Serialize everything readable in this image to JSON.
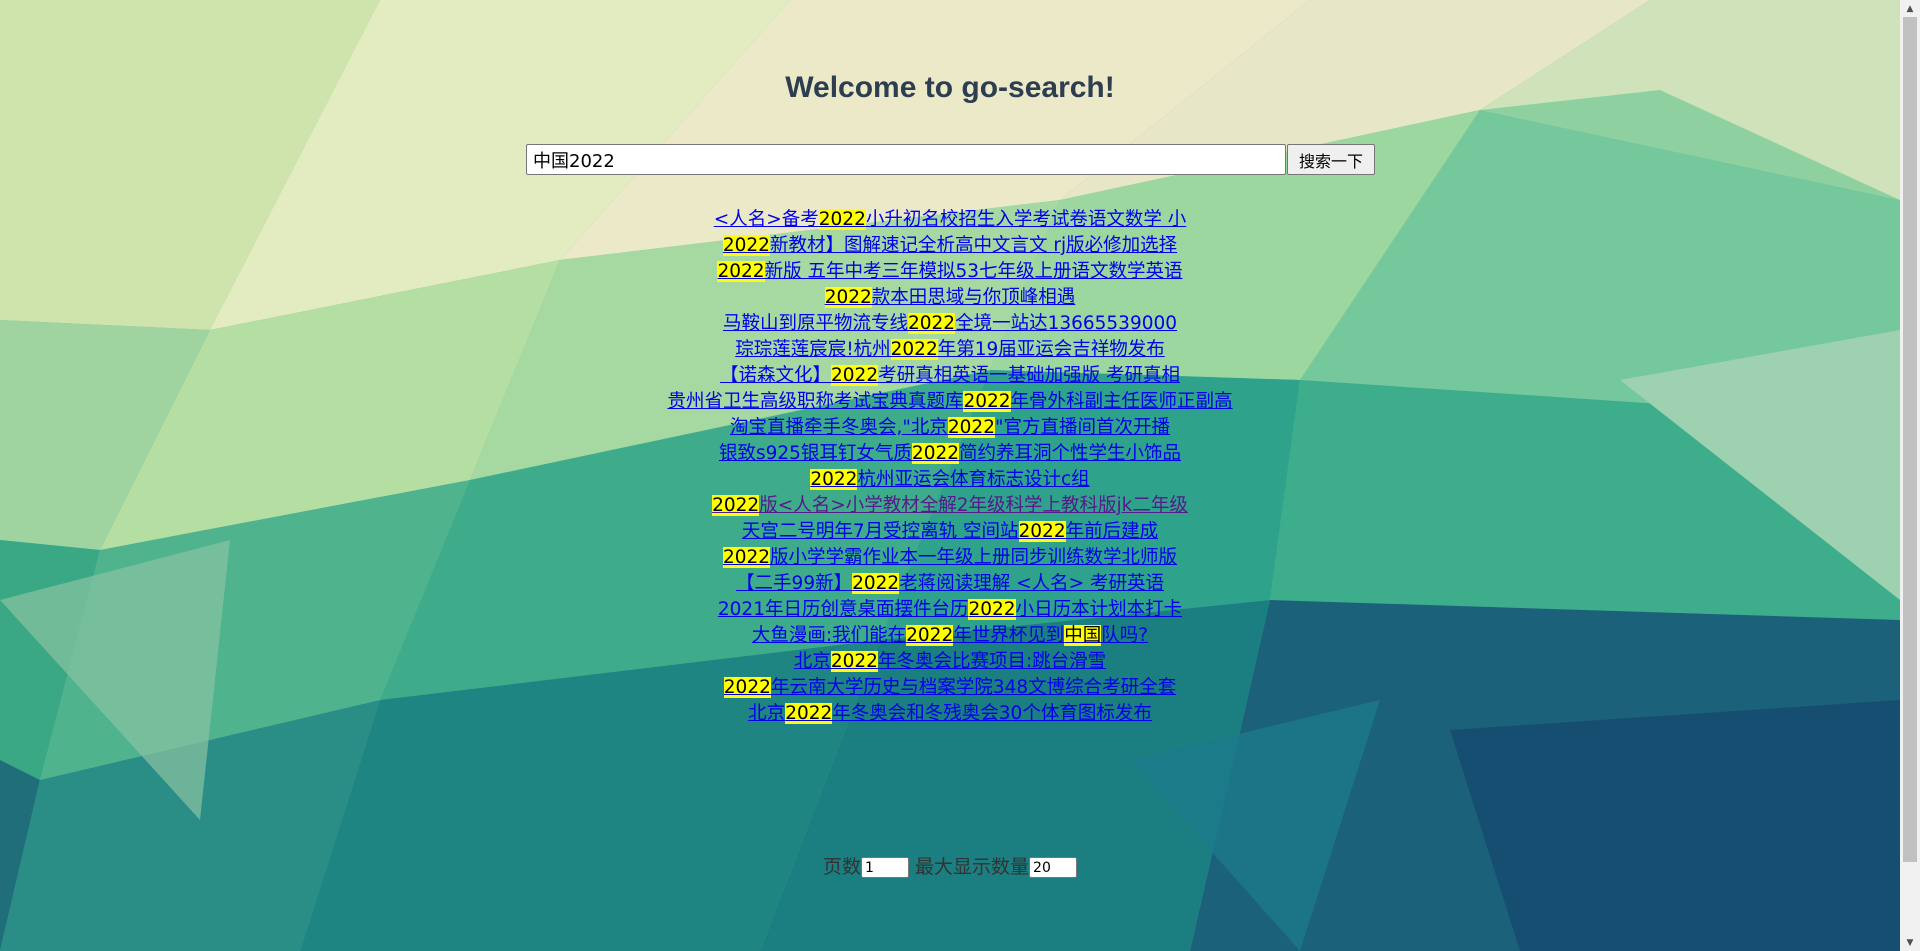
{
  "page": {
    "title": "Welcome to go-search!"
  },
  "search": {
    "value": "中国2022",
    "button_label": "搜索一下"
  },
  "results": [
    {
      "visited": false,
      "parts": [
        {
          "t": "<人名>备考"
        },
        {
          "t": "2022",
          "h": true
        },
        {
          "t": "小升初名校招生入学考试卷语文数学 小"
        }
      ]
    },
    {
      "visited": false,
      "parts": [
        {
          "t": "2022",
          "h": true
        },
        {
          "t": "新教材】图解速记全析高中文言文 rj版必修加选择"
        }
      ]
    },
    {
      "visited": false,
      "parts": [
        {
          "t": "2022",
          "h": true
        },
        {
          "t": "新版 五年中考三年模拟53七年级上册语文数学英语"
        }
      ]
    },
    {
      "visited": false,
      "parts": [
        {
          "t": "2022",
          "h": true
        },
        {
          "t": "款本田思域与你顶峰相遇"
        }
      ]
    },
    {
      "visited": false,
      "parts": [
        {
          "t": "马鞍山到原平物流专线"
        },
        {
          "t": "2022",
          "h": true
        },
        {
          "t": "全境一站达13665539000"
        }
      ]
    },
    {
      "visited": false,
      "parts": [
        {
          "t": "琮琮莲莲宸宸!杭州"
        },
        {
          "t": "2022",
          "h": true
        },
        {
          "t": "年第19届亚运会吉祥物发布"
        }
      ]
    },
    {
      "visited": false,
      "parts": [
        {
          "t": "【诺森文化】"
        },
        {
          "t": "2022",
          "h": true
        },
        {
          "t": "考研真相英语一基础加强版 考研真相"
        }
      ]
    },
    {
      "visited": false,
      "parts": [
        {
          "t": "贵州省卫生高级职称考试宝典真题库"
        },
        {
          "t": "2022",
          "h": true
        },
        {
          "t": "年骨外科副主任医师正副高"
        }
      ]
    },
    {
      "visited": false,
      "parts": [
        {
          "t": "淘宝直播牵手冬奥会,\"北京"
        },
        {
          "t": "2022",
          "h": true
        },
        {
          "t": "\"官方直播间首次开播"
        }
      ]
    },
    {
      "visited": false,
      "parts": [
        {
          "t": "银致s925银耳钉女气质"
        },
        {
          "t": "2022",
          "h": true
        },
        {
          "t": "简约养耳洞个性学生小饰品"
        }
      ]
    },
    {
      "visited": false,
      "parts": [
        {
          "t": "2022",
          "h": true
        },
        {
          "t": "杭州亚运会体育标志设计c组"
        }
      ]
    },
    {
      "visited": true,
      "parts": [
        {
          "t": "2022",
          "h": true
        },
        {
          "t": "版<人名>小学教材全解2年级科学上教科版jk二年级"
        }
      ]
    },
    {
      "visited": false,
      "parts": [
        {
          "t": "天宫二号明年7月受控离轨 空间站"
        },
        {
          "t": "2022",
          "h": true
        },
        {
          "t": "年前后建成"
        }
      ]
    },
    {
      "visited": false,
      "parts": [
        {
          "t": "2022",
          "h": true
        },
        {
          "t": "版小学学霸作业本一年级上册同步训练数学北师版"
        }
      ]
    },
    {
      "visited": false,
      "parts": [
        {
          "t": "【二手99新】"
        },
        {
          "t": "2022",
          "h": true
        },
        {
          "t": "老蒋阅读理解 <人名> 考研英语"
        }
      ]
    },
    {
      "visited": false,
      "parts": [
        {
          "t": "2021年日历创意桌面摆件台历"
        },
        {
          "t": "2022",
          "h": true
        },
        {
          "t": "小日历本计划本打卡"
        }
      ]
    },
    {
      "visited": false,
      "parts": [
        {
          "t": "大鱼漫画:我们能在"
        },
        {
          "t": "2022",
          "h": true
        },
        {
          "t": "年世界杯见到"
        },
        {
          "t": "中国",
          "h": true
        },
        {
          "t": "队吗?"
        }
      ]
    },
    {
      "visited": false,
      "parts": [
        {
          "t": "北京"
        },
        {
          "t": "2022",
          "h": true
        },
        {
          "t": "年冬奥会比赛项目:跳台滑雪"
        }
      ]
    },
    {
      "visited": false,
      "parts": [
        {
          "t": "2022",
          "h": true
        },
        {
          "t": "年云南大学历史与档案学院348文博综合考研全套"
        }
      ]
    },
    {
      "visited": false,
      "parts": [
        {
          "t": "北京"
        },
        {
          "t": "2022",
          "h": true
        },
        {
          "t": "年冬奥会和冬残奥会30个体育图标发布"
        }
      ]
    }
  ],
  "pager": {
    "page_label": "页数",
    "page_value": "1",
    "max_label": "最大显示数量",
    "max_value": "20"
  },
  "colors": {
    "link": "#0000ee",
    "link_visited": "#551a8b",
    "highlight": "#ffff00",
    "title": "#2c3e50"
  },
  "icons": {
    "scroll_up": "triangle-up-icon",
    "scroll_down": "triangle-down-icon"
  }
}
